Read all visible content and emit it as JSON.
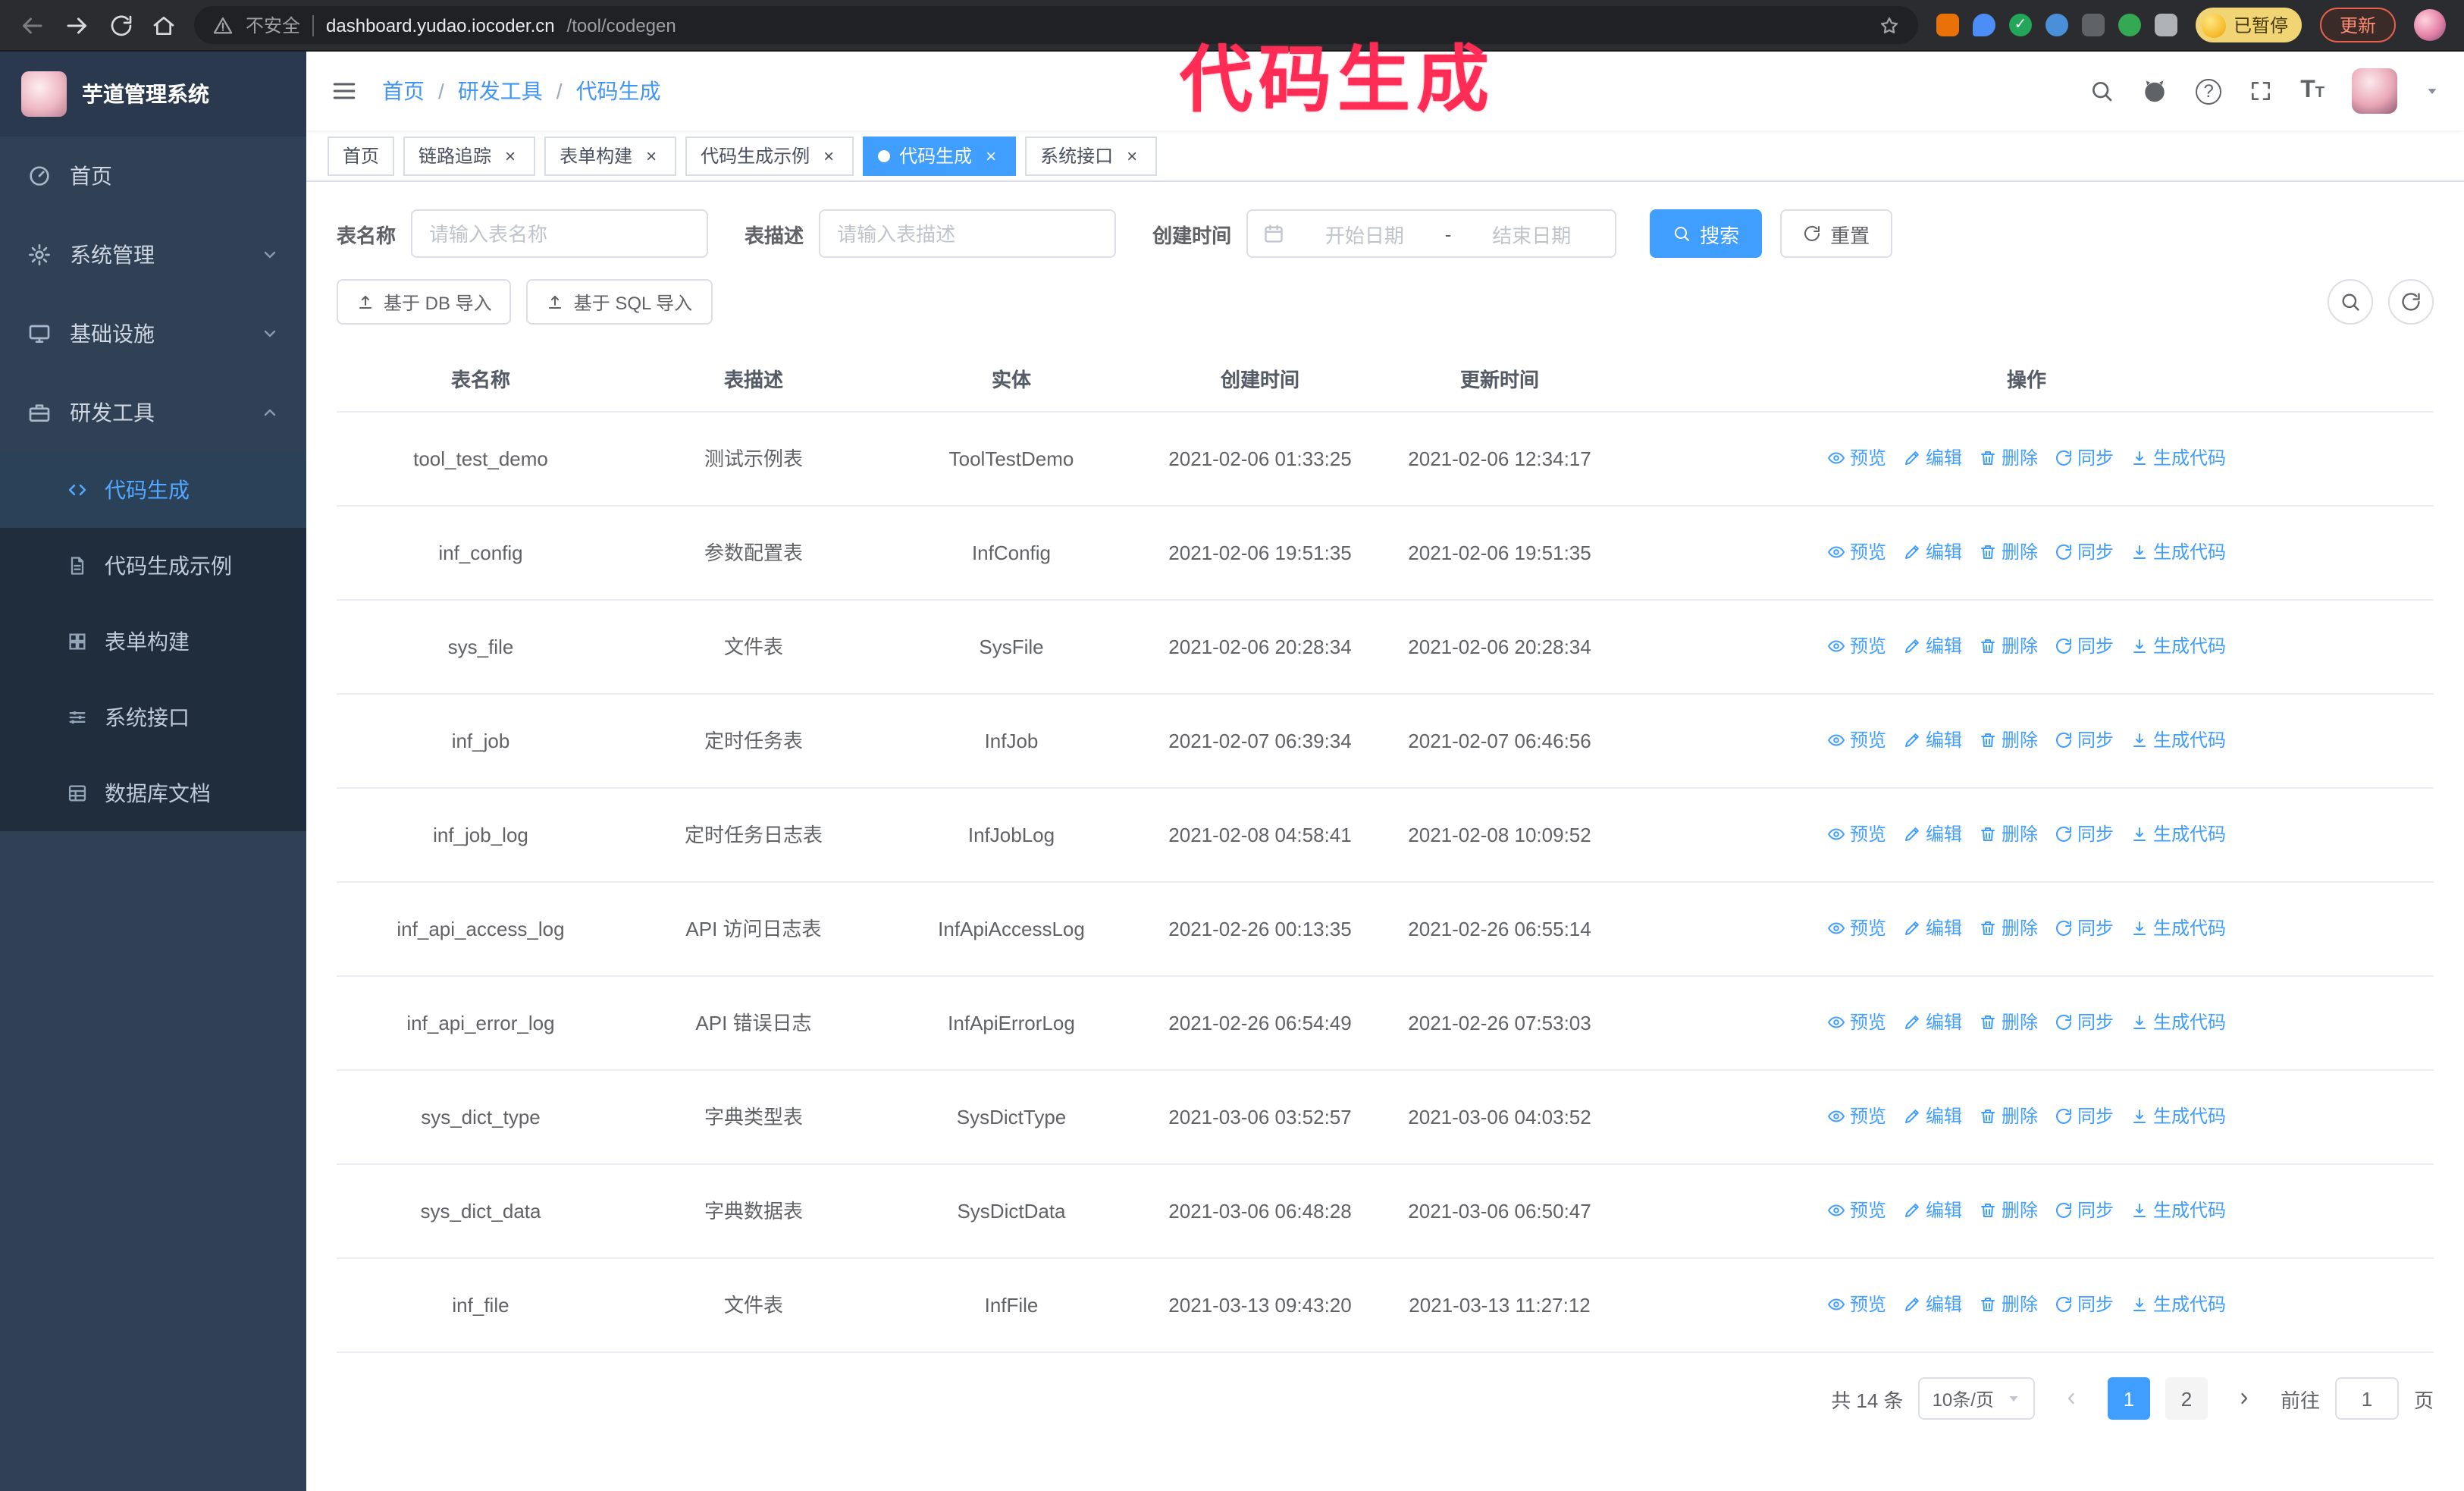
{
  "annotation": {
    "text": "代码生成"
  },
  "browser": {
    "security_label": "不安全",
    "url_host": "dashboard.yudao.iocoder.cn",
    "url_path": "/tool/codegen",
    "paused_badge": "已暂停",
    "update_button": "更新"
  },
  "app": {
    "title": "芋道管理系统",
    "breadcrumb": [
      "首页",
      "研发工具",
      "代码生成"
    ]
  },
  "sidebar": {
    "items": [
      {
        "label": "首页"
      },
      {
        "label": "系统管理"
      },
      {
        "label": "基础设施"
      },
      {
        "label": "研发工具"
      }
    ],
    "sub_items": [
      {
        "label": "代码生成",
        "active": true
      },
      {
        "label": "代码生成示例"
      },
      {
        "label": "表单构建"
      },
      {
        "label": "系统接口"
      },
      {
        "label": "数据库文档"
      }
    ]
  },
  "tabs": [
    {
      "label": "首页",
      "closable": false,
      "active": false
    },
    {
      "label": "链路追踪",
      "closable": true,
      "active": false
    },
    {
      "label": "表单构建",
      "closable": true,
      "active": false
    },
    {
      "label": "代码生成示例",
      "closable": true,
      "active": false
    },
    {
      "label": "代码生成",
      "closable": true,
      "active": true
    },
    {
      "label": "系统接口",
      "closable": true,
      "active": false
    }
  ],
  "filters": {
    "table_name_label": "表名称",
    "table_name_placeholder": "请输入表名称",
    "table_desc_label": "表描述",
    "table_desc_placeholder": "请输入表描述",
    "create_time_label": "创建时间",
    "date_start_placeholder": "开始日期",
    "date_separator": "-",
    "date_end_placeholder": "结束日期",
    "search_button": "搜索",
    "reset_button": "重置"
  },
  "toolbar": {
    "import_db": "基于 DB 导入",
    "import_sql": "基于 SQL 导入"
  },
  "table": {
    "columns": [
      "表名称",
      "表描述",
      "实体",
      "创建时间",
      "更新时间",
      "操作"
    ],
    "action_labels": [
      "预览",
      "编辑",
      "删除",
      "同步",
      "生成代码"
    ],
    "rows": [
      {
        "name": "tool_test_demo",
        "desc": "测试示例表",
        "entity": "ToolTestDemo",
        "created": "2021-02-06 01:33:25",
        "updated": "2021-02-06 12:34:17"
      },
      {
        "name": "inf_config",
        "desc": "参数配置表",
        "entity": "InfConfig",
        "created": "2021-02-06 19:51:35",
        "updated": "2021-02-06 19:51:35"
      },
      {
        "name": "sys_file",
        "desc": "文件表",
        "entity": "SysFile",
        "created": "2021-02-06 20:28:34",
        "updated": "2021-02-06 20:28:34"
      },
      {
        "name": "inf_job",
        "desc": "定时任务表",
        "entity": "InfJob",
        "created": "2021-02-07 06:39:34",
        "updated": "2021-02-07 06:46:56"
      },
      {
        "name": "inf_job_log",
        "desc": "定时任务日志表",
        "entity": "InfJobLog",
        "created": "2021-02-08 04:58:41",
        "updated": "2021-02-08 10:09:52"
      },
      {
        "name": "inf_api_access_log",
        "desc": "API 访问日志表",
        "entity": "InfApiAccessLog",
        "created": "2021-02-26 00:13:35",
        "updated": "2021-02-26 06:55:14"
      },
      {
        "name": "inf_api_error_log",
        "desc": "API 错误日志",
        "entity": "InfApiErrorLog",
        "created": "2021-02-26 06:54:49",
        "updated": "2021-02-26 07:53:03"
      },
      {
        "name": "sys_dict_type",
        "desc": "字典类型表",
        "entity": "SysDictType",
        "created": "2021-03-06 03:52:57",
        "updated": "2021-03-06 04:03:52"
      },
      {
        "name": "sys_dict_data",
        "desc": "字典数据表",
        "entity": "SysDictData",
        "created": "2021-03-06 06:48:28",
        "updated": "2021-03-06 06:50:47"
      },
      {
        "name": "inf_file",
        "desc": "文件表",
        "entity": "InfFile",
        "created": "2021-03-13 09:43:20",
        "updated": "2021-03-13 11:27:12"
      }
    ]
  },
  "pagination": {
    "total_text": "共 14 条",
    "page_size": "10条/页",
    "pages": [
      "1",
      "2"
    ],
    "current_page": "1",
    "goto_prefix": "前往",
    "goto_value": "1",
    "goto_suffix": "页"
  },
  "icons": {
    "browser_back": "arrow-left",
    "browser_forward": "arrow-right",
    "browser_reload": "refresh",
    "browser_home": "home",
    "security": "warning-triangle",
    "bookmark": "star",
    "header_search": "magnifier",
    "repo": "github",
    "help": "question-circle",
    "fullscreen": "expand",
    "font_size": "text-size",
    "sidebar_toggle": "hamburger",
    "preview": "eye",
    "edit": "pencil",
    "delete": "trash",
    "sync": "refresh",
    "generate_code": "download",
    "import": "upload",
    "date_picker": "calendar"
  },
  "colors": {
    "accent": "#409eff",
    "sidebar_bg": "#304156",
    "submenu_bg": "#1f2d3d",
    "tab_active_bg": "#409eff",
    "annotation": "#ff2d55"
  }
}
